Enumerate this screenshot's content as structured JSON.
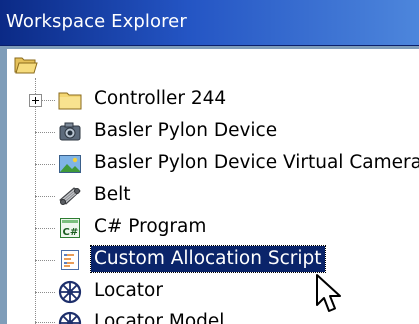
{
  "window": {
    "title": "Workspace Explorer"
  },
  "tree": {
    "root": {
      "icon": "folder-open-icon"
    },
    "items": [
      {
        "label": "Controller 244",
        "icon": "folder-icon",
        "expandable": true
      },
      {
        "label": "Basler Pylon Device",
        "icon": "camera-icon"
      },
      {
        "label": "Basler Pylon Device Virtual Camera",
        "icon": "image-icon"
      },
      {
        "label": "Belt",
        "icon": "conveyor-belt-icon"
      },
      {
        "label": "C# Program",
        "icon": "csharp-program-icon"
      },
      {
        "label": "Custom Allocation Script",
        "icon": "script-icon",
        "selected": true
      },
      {
        "label": "Locator",
        "icon": "locator-icon"
      },
      {
        "label": "Locator Model",
        "icon": "locator-model-icon"
      }
    ]
  },
  "cursor": {
    "icon": "mouse-pointer-icon"
  },
  "colors": {
    "title_bar_start": "#0b2a86",
    "title_bar_end": "#4d86dc",
    "selection": "#0a246a"
  }
}
